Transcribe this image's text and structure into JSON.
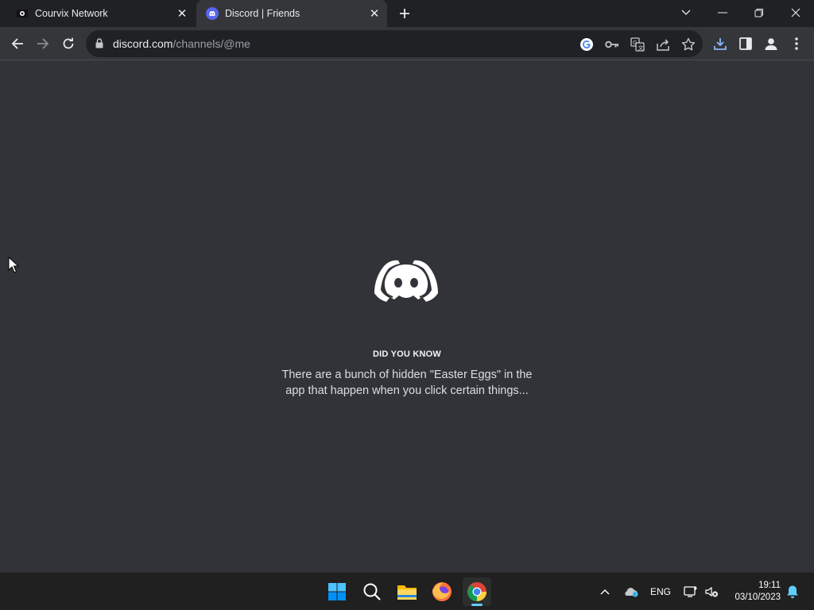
{
  "browser": {
    "tabs": [
      {
        "title": "Courvix Network",
        "icon": "courvix-favicon",
        "active": false
      },
      {
        "title": "Discord | Friends",
        "icon": "discord-favicon",
        "active": true
      }
    ],
    "url_domain": "discord.com",
    "url_path": "/channels/@me"
  },
  "loading": {
    "heading": "DID YOU KNOW",
    "tip": "There are a bunch of hidden \"Easter Eggs\" in the app that happen when you click certain things..."
  },
  "taskbar": {
    "language": "ENG",
    "time": "19:11",
    "date": "03/10/2023"
  },
  "colors": {
    "background": "#313338",
    "tabstrip": "#202124",
    "toolbar": "#35363a",
    "accent": "#5865f2",
    "taskbar": "#202020"
  }
}
